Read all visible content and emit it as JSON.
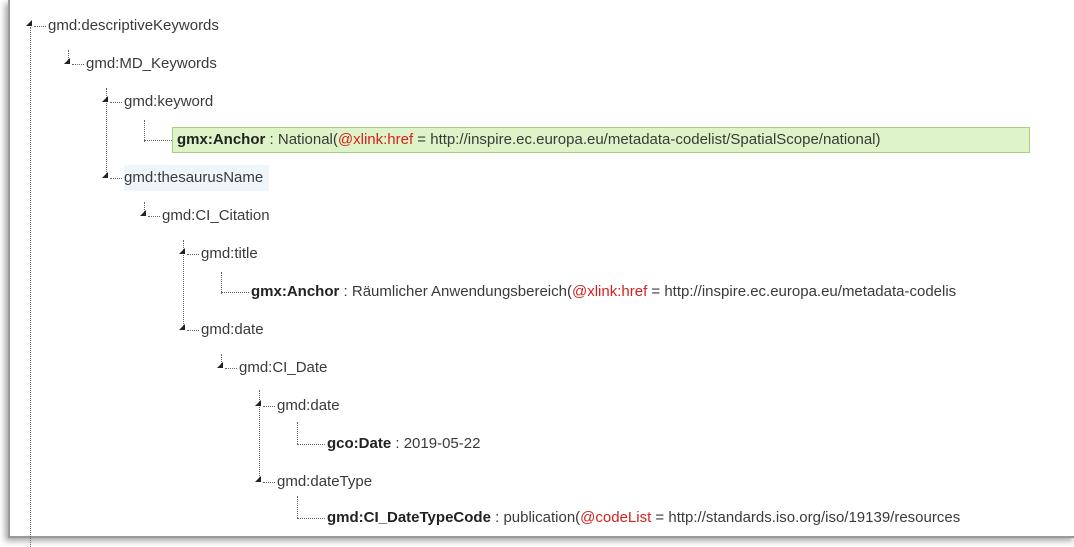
{
  "tree": {
    "n0": "gmd:descriptiveKeywords",
    "n1": "gmd:MD_Keywords",
    "n2": "gmd:keyword",
    "n3": {
      "tag": "gmx:Anchor",
      "sep": " : ",
      "value": "National(",
      "attr": "@xlink:href",
      "eq": " = http://inspire.ec.europa.eu/metadata-codelist/SpatialScope/national)"
    },
    "n4": "gmd:thesaurusName",
    "n5": "gmd:CI_Citation",
    "n6": "gmd:title",
    "n7": {
      "tag": "gmx:Anchor",
      "sep": " : ",
      "value": "Räumlicher Anwendungsbereich(",
      "attr": "@xlink:href",
      "eq": " = http://inspire.ec.europa.eu/metadata-codelis"
    },
    "n8": "gmd:date",
    "n9": "gmd:CI_Date",
    "n10": "gmd:date",
    "n11": {
      "tag": "gco:Date",
      "sep": " : ",
      "value": "2019-05-22"
    },
    "n12": "gmd:dateType",
    "n13": {
      "tag": "gmd:CI_DateTypeCode",
      "sep": " : ",
      "value": "publication(",
      "attr": "@codeList",
      "eq": " = http://standards.iso.org/iso/19139/resources"
    }
  }
}
